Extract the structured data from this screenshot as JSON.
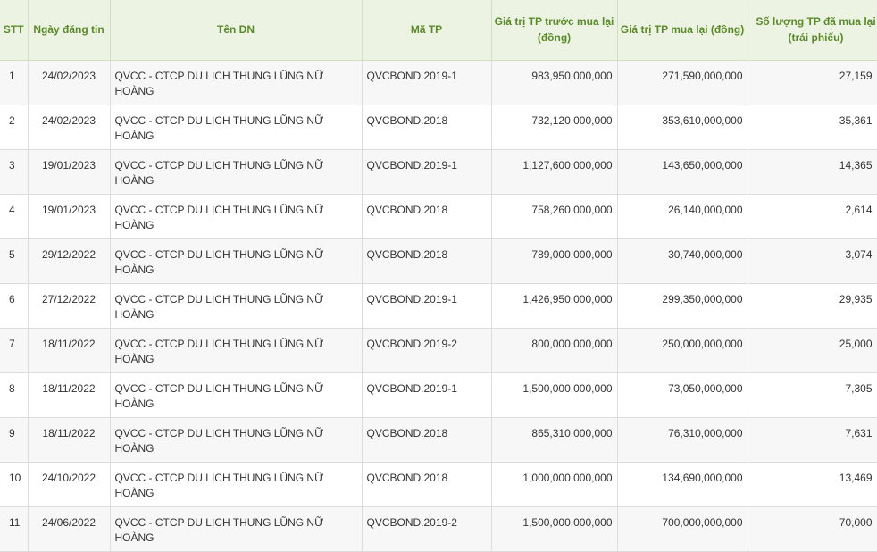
{
  "table": {
    "headers": [
      "STT",
      "Ngày đăng tin",
      "Tên DN",
      "Mã TP",
      "Giá trị TP trước mua lại (đồng)",
      "Giá trị TP mua lại (đồng)",
      "Số lượng TP đã mua lại (trái phiếu)"
    ],
    "rows": [
      {
        "stt": "1",
        "date": "24/02/2023",
        "company": "QVCC - CTCP DU LỊCH THUNG LŨNG NỮ HOÀNG",
        "code": "QVCBOND.2019-1",
        "value_before": "983,950,000,000",
        "value_bought": "271,590,000,000",
        "quantity": "27,159"
      },
      {
        "stt": "2",
        "date": "24/02/2023",
        "company": "QVCC - CTCP DU LỊCH THUNG LŨNG NỮ HOÀNG",
        "code": "QVCBOND.2018",
        "value_before": "732,120,000,000",
        "value_bought": "353,610,000,000",
        "quantity": "35,361"
      },
      {
        "stt": "3",
        "date": "19/01/2023",
        "company": "QVCC - CTCP DU LỊCH THUNG LŨNG NỮ HOÀNG",
        "code": "QVCBOND.2019-1",
        "value_before": "1,127,600,000,000",
        "value_bought": "143,650,000,000",
        "quantity": "14,365"
      },
      {
        "stt": "4",
        "date": "19/01/2023",
        "company": "QVCC - CTCP DU LỊCH THUNG LŨNG NỮ HOÀNG",
        "code": "QVCBOND.2018",
        "value_before": "758,260,000,000",
        "value_bought": "26,140,000,000",
        "quantity": "2,614"
      },
      {
        "stt": "5",
        "date": "29/12/2022",
        "company": "QVCC - CTCP DU LỊCH THUNG LŨNG NỮ HOÀNG",
        "code": "QVCBOND.2018",
        "value_before": "789,000,000,000",
        "value_bought": "30,740,000,000",
        "quantity": "3,074"
      },
      {
        "stt": "6",
        "date": "27/12/2022",
        "company": "QVCC - CTCP DU LỊCH THUNG LŨNG NỮ HOÀNG",
        "code": "QVCBOND.2019-1",
        "value_before": "1,426,950,000,000",
        "value_bought": "299,350,000,000",
        "quantity": "29,935"
      },
      {
        "stt": "7",
        "date": "18/11/2022",
        "company": "QVCC - CTCP DU LỊCH THUNG LŨNG NỮ HOÀNG",
        "code": "QVCBOND.2019-2",
        "value_before": "800,000,000,000",
        "value_bought": "250,000,000,000",
        "quantity": "25,000"
      },
      {
        "stt": "8",
        "date": "18/11/2022",
        "company": "QVCC - CTCP DU LỊCH THUNG LŨNG NỮ HOÀNG",
        "code": "QVCBOND.2019-1",
        "value_before": "1,500,000,000,000",
        "value_bought": "73,050,000,000",
        "quantity": "7,305"
      },
      {
        "stt": "9",
        "date": "18/11/2022",
        "company": "QVCC - CTCP DU LỊCH THUNG LŨNG NỮ HOÀNG",
        "code": "QVCBOND.2018",
        "value_before": "865,310,000,000",
        "value_bought": "76,310,000,000",
        "quantity": "7,631"
      },
      {
        "stt": "10",
        "date": "24/10/2022",
        "company": "QVCC - CTCP DU LỊCH THUNG LŨNG NỮ HOÀNG",
        "code": "QVCBOND.2018",
        "value_before": "1,000,000,000,000",
        "value_bought": "134,690,000,000",
        "quantity": "13,469"
      },
      {
        "stt": "11",
        "date": "24/06/2022",
        "company": "QVCC - CTCP DU LỊCH THUNG LŨNG NỮ HOÀNG",
        "code": "QVCBOND.2019-2",
        "value_before": "1,500,000,000,000",
        "value_bought": "700,000,000,000",
        "quantity": "70,000"
      }
    ]
  },
  "colors": {
    "header_background": "#ecf3e2",
    "header_text": "#5b8a2a",
    "row_odd_background": "#f7f7f7",
    "row_even_background": "#ffffff",
    "cell_text": "#333333"
  }
}
